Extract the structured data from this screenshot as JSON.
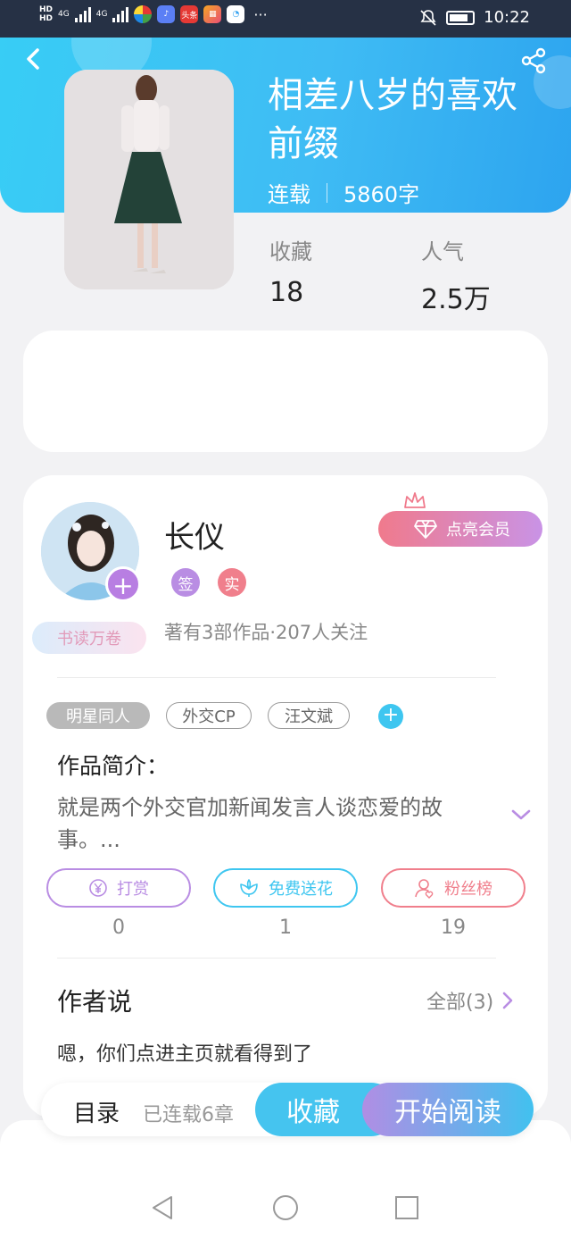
{
  "status_bar": {
    "hd_top": "HD",
    "hd_bottom": "HD",
    "net1": "4G",
    "net2": "4G",
    "app_icon_label": "头条",
    "more": "···",
    "time": "10:22"
  },
  "book": {
    "title": "相差八岁的喜欢前缀",
    "status": "连载",
    "word_count": "5860字",
    "stats": [
      {
        "label": "收藏",
        "value": "18"
      },
      {
        "label": "人气",
        "value": "2.5万"
      }
    ]
  },
  "author": {
    "name": "长仪",
    "badges": [
      {
        "text": "签",
        "color": "#b98de3"
      },
      {
        "text": "实",
        "color": "#f07f8c"
      }
    ],
    "works_info": "著有3部作品·207人关注",
    "reader_badge": "书读万卷",
    "vip_button": "点亮会员"
  },
  "tags": [
    "明星同人",
    "外交CP",
    "汪文斌"
  ],
  "intro": {
    "heading": "作品简介：",
    "text": "就是两个外交官加新闻发言人谈恋爱的故事。..."
  },
  "actions": [
    {
      "label": "打赏",
      "count": "0",
      "color": "#b98de3",
      "icon": "yen-icon"
    },
    {
      "label": "免费送花",
      "count": "1",
      "color": "#3ec6f0",
      "icon": "flower-icon"
    },
    {
      "label": "粉丝榜",
      "count": "19",
      "color": "#f07f8c",
      "icon": "fans-icon"
    }
  ],
  "author_says": {
    "heading": "作者说",
    "all_label": "全部(3)",
    "message": "嗯，你们点进主页就看得到了"
  },
  "bottom_bar": {
    "toc_label": "目录",
    "chapters": "已连载6章",
    "favorite": "收藏",
    "start_reading": "开始阅读"
  },
  "colors": {
    "header_blue": "#38cdf5",
    "accent_purple": "#b87ee2",
    "accent_pink": "#f07a8c",
    "accent_cyan": "#3ec6f0"
  }
}
